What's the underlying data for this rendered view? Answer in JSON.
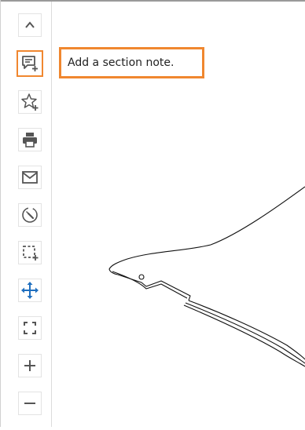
{
  "toolbar": {
    "tools": [
      {
        "icon": "chevron-up-icon",
        "active": false
      },
      {
        "icon": "add-note-icon",
        "active": true
      },
      {
        "icon": "star-add-icon",
        "active": false
      },
      {
        "icon": "printer-icon",
        "active": false
      },
      {
        "icon": "envelope-icon",
        "active": false
      },
      {
        "icon": "wrench-circle-icon",
        "active": false
      },
      {
        "icon": "select-area-add-icon",
        "active": false
      },
      {
        "icon": "move-arrows-icon",
        "active": false
      },
      {
        "icon": "fit-screen-icon",
        "active": false
      },
      {
        "icon": "zoom-in-icon",
        "active": false
      },
      {
        "icon": "zoom-out-icon",
        "active": false
      }
    ]
  },
  "tooltip": {
    "text": "Add a section note."
  },
  "colors": {
    "highlight": "#f0872f",
    "icon": "#555555",
    "move_icon": "#1f6fbf",
    "drawing_line": "#111111"
  }
}
